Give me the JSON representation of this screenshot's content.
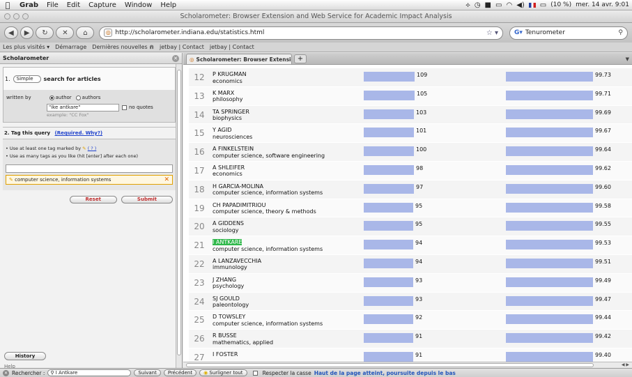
{
  "menubar": {
    "apple": "",
    "items": [
      "Grab",
      "File",
      "Edit",
      "Capture",
      "Window",
      "Help"
    ],
    "battery": "(10 %)",
    "clock": "mer. 14 avr.  9:01"
  },
  "window": {
    "title": "Scholarometer: Browser Extension and Web Service for Academic Impact Analysis"
  },
  "toolbar": {
    "back": "◀",
    "forward": "▶",
    "url": "http://scholarometer.indiana.edu/statistics.html",
    "search_value": "Tenurometer"
  },
  "bookmarks": [
    "Les plus visités ▾",
    "Démarrage",
    "Dernières nouvelles ⋒",
    "jetbay | Contact",
    "jetbay | Contact"
  ],
  "sidebar": {
    "title": "Scholarometer",
    "step1_num": "1.",
    "search_mode": "Simple",
    "search_label": "search for articles",
    "written_by": "written by",
    "author": "author",
    "authors": "authors",
    "author_value": "\"ike antkare\"",
    "no_quotes": "no quotes",
    "example": "example:   \"CC Fox\"",
    "step2": "2. Tag this query",
    "required_link": "(Required. Why?)",
    "bullet1": "• Use at least one tag marked by",
    "bullet1_help": "( ? )",
    "bullet2": "• Use as many tags as you like (hit [enter] after each one)",
    "tag": "computer science, information systems",
    "reset": "Reset",
    "submit": "Submit",
    "history": "History",
    "help": "Help"
  },
  "tab": {
    "label": "Scholarometer: Browser Extension..."
  },
  "table": {
    "rows": [
      {
        "rank": "12",
        "name": "P KRUGMAN",
        "field": "economics",
        "v1": 109,
        "v2": "99.73",
        "hl": false
      },
      {
        "rank": "13",
        "name": "K MARX",
        "field": "philosophy",
        "v1": 105,
        "v2": "99.71",
        "hl": false
      },
      {
        "rank": "14",
        "name": "TA SPRINGER",
        "field": "biophysics",
        "v1": 103,
        "v2": "99.69",
        "hl": false
      },
      {
        "rank": "15",
        "name": "Y AGID",
        "field": "neurosciences",
        "v1": 101,
        "v2": "99.67",
        "hl": false
      },
      {
        "rank": "16",
        "name": "A FINKELSTEIN",
        "field": "computer science, software engineering",
        "v1": 100,
        "v2": "99.64",
        "hl": false
      },
      {
        "rank": "17",
        "name": "A SHLEIFER",
        "field": "economics",
        "v1": 98,
        "v2": "99.62",
        "hl": false
      },
      {
        "rank": "18",
        "name": "H GARCIA-MOLINA",
        "field": "computer science, information systems",
        "v1": 97,
        "v2": "99.60",
        "hl": false
      },
      {
        "rank": "19",
        "name": "CH PAPADIMITRIOU",
        "field": "computer science, theory & methods",
        "v1": 95,
        "v2": "99.58",
        "hl": false
      },
      {
        "rank": "20",
        "name": "A GIDDENS",
        "field": "sociology",
        "v1": 95,
        "v2": "99.55",
        "hl": false
      },
      {
        "rank": "21",
        "name": "I ANTKARE",
        "field": "computer science, information systems",
        "v1": 94,
        "v2": "99.53",
        "hl": true
      },
      {
        "rank": "22",
        "name": "A LANZAVECCHIA",
        "field": "immunology",
        "v1": 94,
        "v2": "99.51",
        "hl": false
      },
      {
        "rank": "23",
        "name": "J ZHANG",
        "field": "psychology",
        "v1": 93,
        "v2": "99.49",
        "hl": false
      },
      {
        "rank": "24",
        "name": "SJ GOULD",
        "field": "paleontology",
        "v1": 93,
        "v2": "99.47",
        "hl": false
      },
      {
        "rank": "25",
        "name": "D TOWSLEY",
        "field": "computer science, information systems",
        "v1": 92,
        "v2": "99.44",
        "hl": false
      },
      {
        "rank": "26",
        "name": "R BUSSE",
        "field": "mathematics, applied",
        "v1": 91,
        "v2": "99.42",
        "hl": false
      },
      {
        "rank": "27",
        "name": "I FOSTER",
        "field": "",
        "v1": 91,
        "v2": "99.40",
        "hl": false
      }
    ]
  },
  "findbar": {
    "label": "Rechercher :",
    "value": "I Antkare",
    "next": "Suivant",
    "prev": "Précédent",
    "highlight": "Surligner tout",
    "match_case": "Respecter la casse",
    "status": "Haut de la page atteint, poursuite depuis le bas"
  }
}
